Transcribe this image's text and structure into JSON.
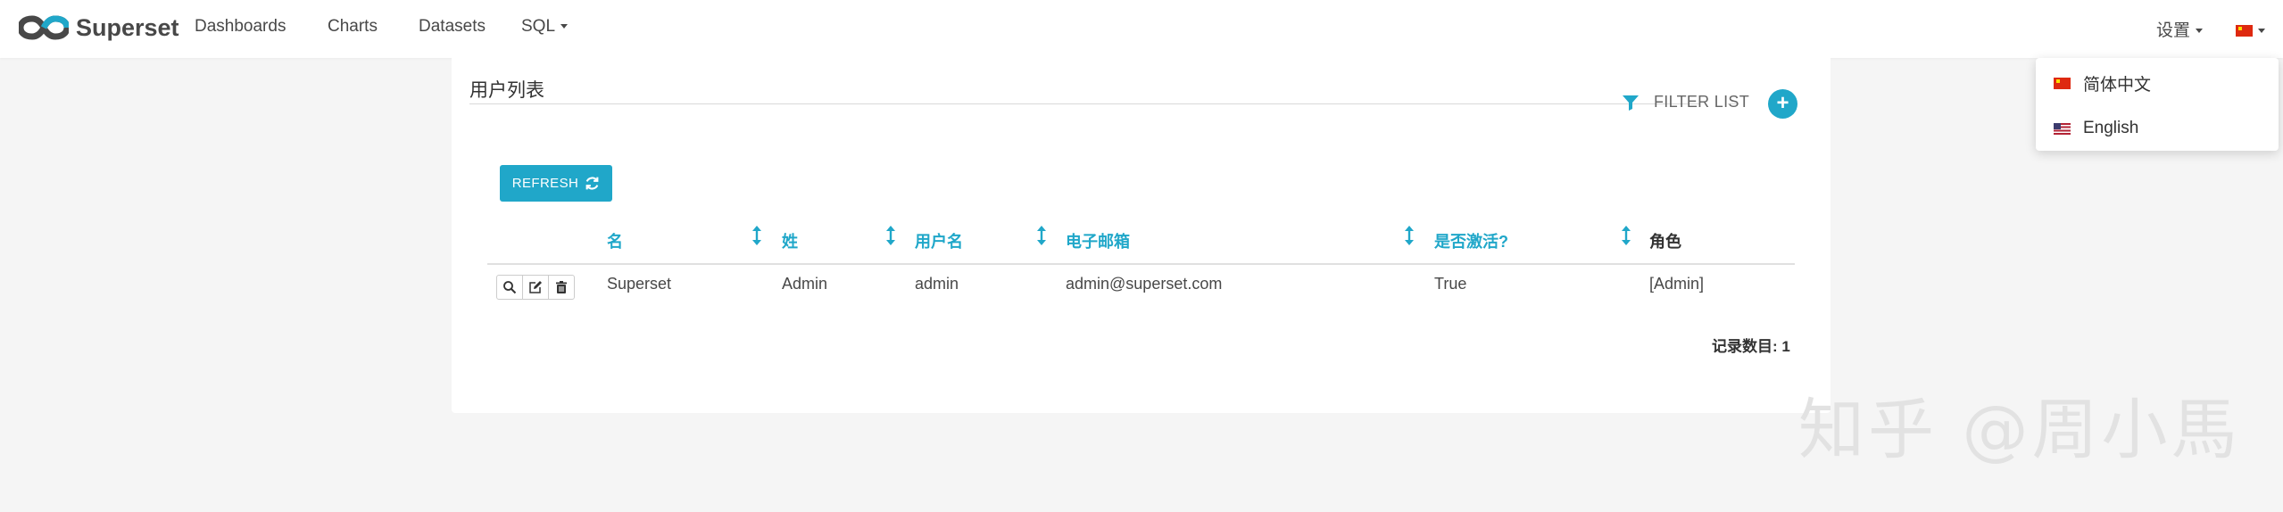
{
  "navbar": {
    "brand": "Superset",
    "items": [
      {
        "label": "Dashboards"
      },
      {
        "label": "Charts"
      },
      {
        "label": "Datasets"
      },
      {
        "label": "SQL"
      }
    ],
    "settings_label": "设置"
  },
  "language_menu": {
    "items": [
      {
        "label": "简体中文",
        "flag": "cn"
      },
      {
        "label": "English",
        "flag": "us"
      }
    ]
  },
  "panel": {
    "title": "用户列表",
    "filter_label": "FILTER LIST",
    "add_icon": "plus-icon",
    "refresh_label": "REFRESH",
    "columns": [
      "名",
      "姓",
      "用户名",
      "电子邮箱",
      "是否激活?",
      "角色"
    ],
    "rows": [
      {
        "first_name": "Superset",
        "last_name": "Admin",
        "username": "admin",
        "email": "admin@superset.com",
        "active": "True",
        "roles": "[Admin]"
      }
    ],
    "record_count": "记录数目: 1"
  },
  "watermark": "知乎 @周小馬",
  "colors": {
    "accent": "#20a7c9",
    "background": "#f5f5f5",
    "panel": "#ffffff"
  }
}
